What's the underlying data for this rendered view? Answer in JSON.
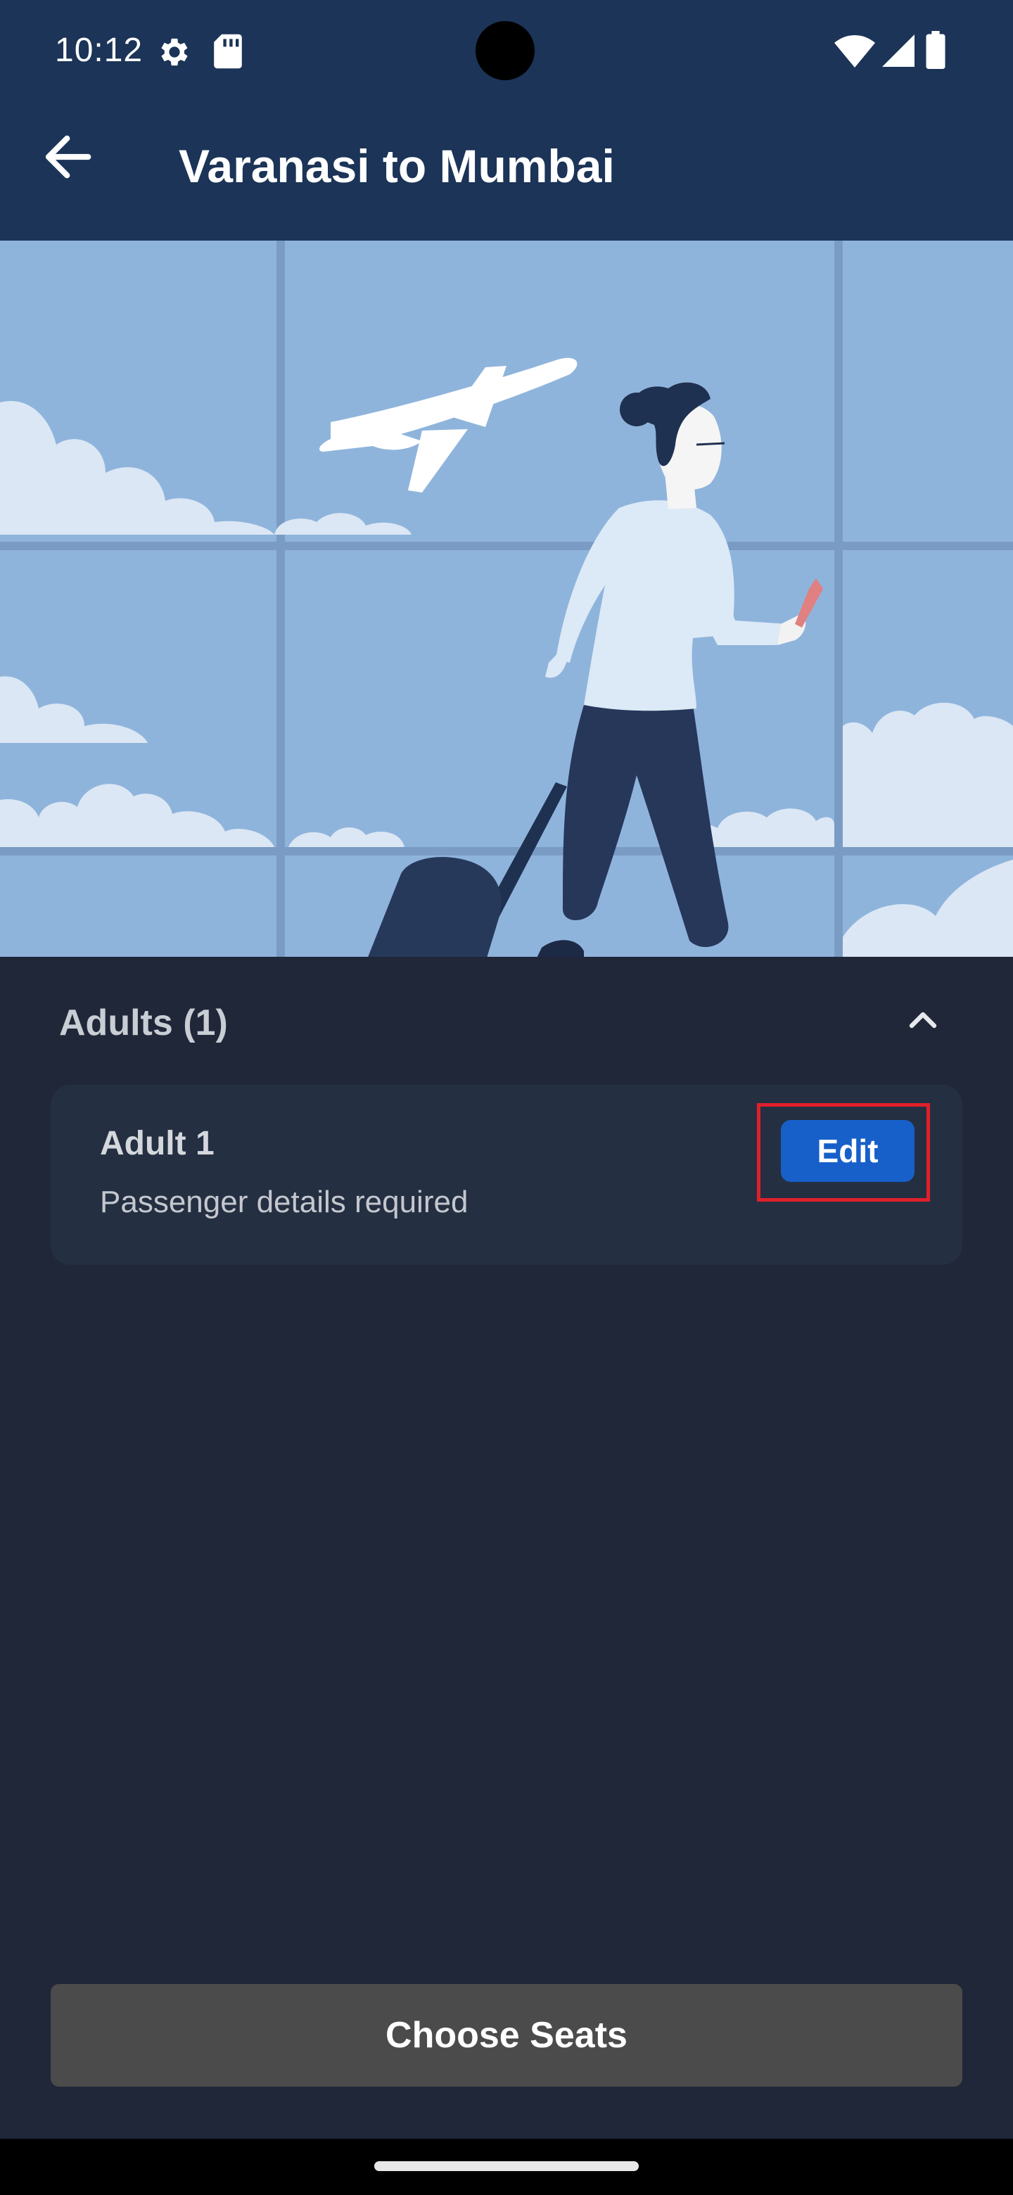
{
  "status_bar": {
    "time": "10:12",
    "icons": [
      "gear-icon",
      "sd-card-icon",
      "wifi-icon",
      "signal-icon",
      "battery-icon"
    ]
  },
  "app_bar": {
    "title": "Varanasi to Mumbai",
    "back_icon": "arrow-left-icon"
  },
  "hero": {
    "illustration": "traveler-with-suitcase-airport-window"
  },
  "passengers": {
    "section_title": "Adults (1)",
    "collapse_icon": "chevron-up-icon",
    "items": [
      {
        "name": "Adult 1",
        "status": "Passenger details required",
        "action_label": "Edit"
      }
    ]
  },
  "footer": {
    "choose_seats_label": "Choose Seats"
  },
  "colors": {
    "app_bar": "#1b3457",
    "background": "#1f2738",
    "card": "#242f42",
    "edit_button": "#1760c9",
    "highlight": "#e0202a",
    "primary_button_disabled": "#4b4b4b"
  }
}
